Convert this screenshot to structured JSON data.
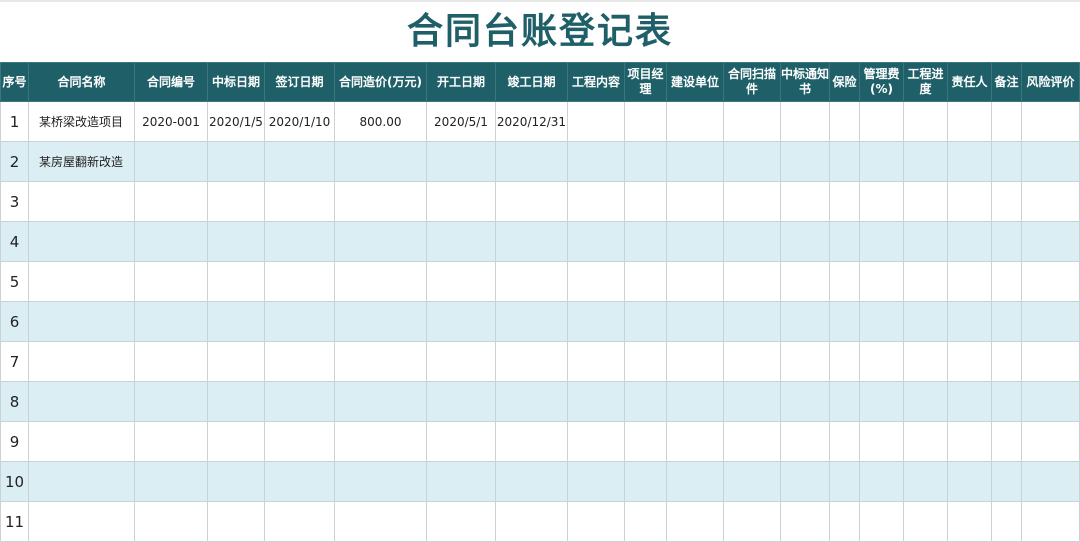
{
  "title": "合同台账登记表",
  "colors": {
    "header_bg": "#1e5f68",
    "title_color": "#1e5f68",
    "alt_row_bg": "#dbeef3"
  },
  "columns": [
    "序号",
    "合同名称",
    "合同编号",
    "中标日期",
    "签订日期",
    "合同造价(万元)",
    "开工日期",
    "竣工日期",
    "工程内容",
    "项目经理",
    "建设单位",
    "合同扫描件",
    "中标通知书",
    "保险",
    "管理费(%)",
    "工程进度",
    "责任人",
    "备注",
    "风险评价"
  ],
  "rows": [
    [
      "1",
      "某桥梁改造项目",
      "2020-001",
      "2020/1/5",
      "2020/1/10",
      "800.00",
      "2020/5/1",
      "2020/12/31",
      "",
      "",
      "",
      "",
      "",
      "",
      "",
      "",
      "",
      "",
      ""
    ],
    [
      "2",
      "某房屋翻新改造",
      "",
      "",
      "",
      "",
      "",
      "",
      "",
      "",
      "",
      "",
      "",
      "",
      "",
      "",
      "",
      "",
      ""
    ],
    [
      "3",
      "",
      "",
      "",
      "",
      "",
      "",
      "",
      "",
      "",
      "",
      "",
      "",
      "",
      "",
      "",
      "",
      "",
      ""
    ],
    [
      "4",
      "",
      "",
      "",
      "",
      "",
      "",
      "",
      "",
      "",
      "",
      "",
      "",
      "",
      "",
      "",
      "",
      "",
      ""
    ],
    [
      "5",
      "",
      "",
      "",
      "",
      "",
      "",
      "",
      "",
      "",
      "",
      "",
      "",
      "",
      "",
      "",
      "",
      "",
      ""
    ],
    [
      "6",
      "",
      "",
      "",
      "",
      "",
      "",
      "",
      "",
      "",
      "",
      "",
      "",
      "",
      "",
      "",
      "",
      "",
      ""
    ],
    [
      "7",
      "",
      "",
      "",
      "",
      "",
      "",
      "",
      "",
      "",
      "",
      "",
      "",
      "",
      "",
      "",
      "",
      "",
      ""
    ],
    [
      "8",
      "",
      "",
      "",
      "",
      "",
      "",
      "",
      "",
      "",
      "",
      "",
      "",
      "",
      "",
      "",
      "",
      "",
      ""
    ],
    [
      "9",
      "",
      "",
      "",
      "",
      "",
      "",
      "",
      "",
      "",
      "",
      "",
      "",
      "",
      "",
      "",
      "",
      "",
      ""
    ],
    [
      "10",
      "",
      "",
      "",
      "",
      "",
      "",
      "",
      "",
      "",
      "",
      "",
      "",
      "",
      "",
      "",
      "",
      "",
      ""
    ],
    [
      "11",
      "",
      "",
      "",
      "",
      "",
      "",
      "",
      "",
      "",
      "",
      "",
      "",
      "",
      "",
      "",
      "",
      "",
      ""
    ]
  ]
}
